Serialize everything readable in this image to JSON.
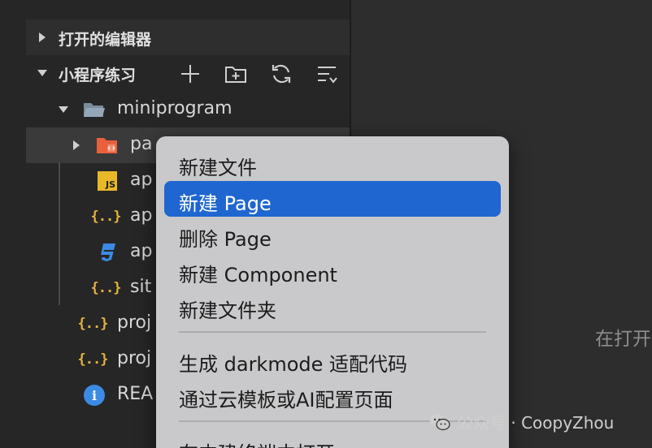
{
  "explorer": {
    "sections": [
      {
        "label": "打开的编辑器",
        "expanded": false
      },
      {
        "label": "小程序练习",
        "expanded": true
      }
    ],
    "toolbar_icons": [
      "new-file-icon",
      "new-folder-icon",
      "refresh-icon",
      "collapse-all-icon"
    ],
    "tree": [
      {
        "label": "miniprogram",
        "icon": "folder-open-icon",
        "expanded": true
      },
      {
        "label": "pa",
        "icon": "pages-folder-icon",
        "expanded": false,
        "selected": true
      },
      {
        "label": "ap",
        "icon": "js-file-icon",
        "badge": "JS"
      },
      {
        "label": "ap",
        "icon": "json-file-icon",
        "badge": "{..}"
      },
      {
        "label": "ap",
        "icon": "css3-file-icon"
      },
      {
        "label": "sit",
        "icon": "json-file-icon",
        "badge": "{..}"
      },
      {
        "label": "proj",
        "icon": "json-file-icon",
        "badge": "{..}"
      },
      {
        "label": "proj",
        "icon": "json-file-icon",
        "badge": "{..}"
      },
      {
        "label": "REA",
        "icon": "info-icon",
        "badge": "i"
      }
    ]
  },
  "context_menu": {
    "items": [
      {
        "label": "新建文件",
        "highlighted": false
      },
      {
        "label": "新建 Page",
        "highlighted": true
      },
      {
        "label": "删除 Page",
        "highlighted": false
      },
      {
        "label": "新建 Component",
        "highlighted": false
      },
      {
        "label": "新建文件夹",
        "highlighted": false
      },
      {
        "label": "生成 darkmode 适配代码",
        "highlighted": false
      },
      {
        "label": "通过云模板或AI配置页面",
        "highlighted": false
      },
      {
        "label": "在内建终端中打开",
        "highlighted": false
      }
    ]
  },
  "editor": {
    "hint": "在打开"
  },
  "watermark": {
    "text": "公众号 · CoopyZhou"
  },
  "colors": {
    "highlight": "#1f66d1",
    "json": "#e3b341",
    "js": "#e9b829",
    "css": "#3b8be6",
    "pages_folder": "#e8603c"
  }
}
